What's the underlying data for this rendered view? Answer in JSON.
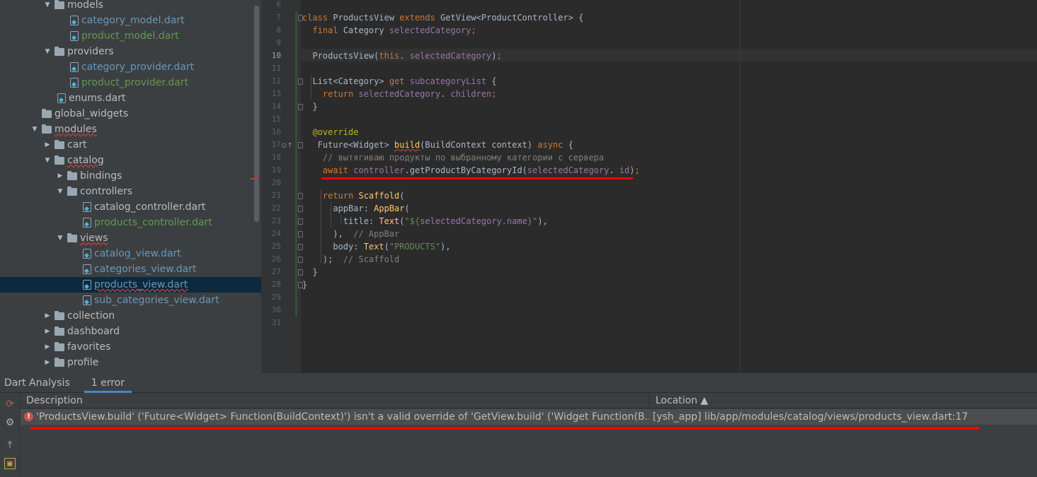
{
  "project_tree": {
    "items": [
      {
        "label": "models",
        "type": "folder",
        "expanded": true,
        "indent": 4,
        "color": "plain"
      },
      {
        "label": "category_model.dart",
        "type": "file",
        "indent": 6,
        "color": "blue"
      },
      {
        "label": "product_model.dart",
        "type": "file",
        "indent": 6,
        "color": "green"
      },
      {
        "label": "providers",
        "type": "folder",
        "expanded": true,
        "indent": 4,
        "color": "plain"
      },
      {
        "label": "category_provider.dart",
        "type": "file",
        "indent": 6,
        "color": "blue"
      },
      {
        "label": "product_provider.dart",
        "type": "file",
        "indent": 6,
        "color": "green"
      },
      {
        "label": "enums.dart",
        "type": "file",
        "indent": 5,
        "color": "plain"
      },
      {
        "label": "global_widgets",
        "type": "folder",
        "leaf": true,
        "indent": 3,
        "color": "plain"
      },
      {
        "label": "modules",
        "type": "folder",
        "expanded": true,
        "indent": 3,
        "color": "plain",
        "underlined": true
      },
      {
        "label": "cart",
        "type": "folder",
        "expanded": false,
        "indent": 4,
        "color": "plain"
      },
      {
        "label": "catalog",
        "type": "folder",
        "expanded": true,
        "indent": 4,
        "color": "plain",
        "underlined": true
      },
      {
        "label": "bindings",
        "type": "folder",
        "expanded": false,
        "indent": 5,
        "color": "plain"
      },
      {
        "label": "controllers",
        "type": "folder",
        "expanded": true,
        "indent": 5,
        "color": "plain"
      },
      {
        "label": "catalog_controller.dart",
        "type": "file",
        "indent": 7,
        "color": "plain"
      },
      {
        "label": "products_controller.dart",
        "type": "file",
        "indent": 7,
        "color": "green"
      },
      {
        "label": "views",
        "type": "folder",
        "expanded": true,
        "indent": 5,
        "color": "plain",
        "underlined": true
      },
      {
        "label": "catalog_view.dart",
        "type": "file",
        "indent": 7,
        "color": "blue"
      },
      {
        "label": "categories_view.dart",
        "type": "file",
        "indent": 7,
        "color": "blue"
      },
      {
        "label": "products_view.dart",
        "type": "file",
        "indent": 7,
        "color": "blue",
        "underlined": true,
        "selected": true
      },
      {
        "label": "sub_categories_view.dart",
        "type": "file",
        "indent": 7,
        "color": "blue"
      },
      {
        "label": "collection",
        "type": "folder",
        "expanded": false,
        "indent": 4,
        "color": "plain"
      },
      {
        "label": "dashboard",
        "type": "folder",
        "expanded": false,
        "indent": 4,
        "color": "plain"
      },
      {
        "label": "favorites",
        "type": "folder",
        "expanded": false,
        "indent": 4,
        "color": "plain"
      },
      {
        "label": "profile",
        "type": "folder",
        "expanded": false,
        "indent": 4,
        "color": "plain"
      }
    ]
  },
  "editor": {
    "current_line": "10",
    "lines": [
      {
        "n": "6",
        "tokens": []
      },
      {
        "n": "7",
        "tokens": [
          [
            "kw",
            "class "
          ],
          [
            "",
            "ProductsView "
          ],
          [
            "kw",
            "extends "
          ],
          [
            "",
            "GetView<ProductController> {"
          ]
        ]
      },
      {
        "n": "8",
        "tokens": [
          [
            "",
            "  "
          ],
          [
            "kw",
            "final "
          ],
          [
            "",
            "Category "
          ],
          [
            "fld",
            "selectedCategory"
          ],
          [
            "kw",
            ";"
          ]
        ]
      },
      {
        "n": "9",
        "tokens": []
      },
      {
        "n": "10",
        "tokens": [
          [
            "",
            "  ProductsView("
          ],
          [
            "kw",
            "this"
          ],
          [
            "",
            ". "
          ],
          [
            "fld",
            "selectedCategory"
          ],
          [
            "",
            ")"
          ],
          [
            "kw",
            ";"
          ]
        ]
      },
      {
        "n": "11",
        "tokens": []
      },
      {
        "n": "12",
        "tokens": [
          [
            "",
            "  List<Category> "
          ],
          [
            "kw",
            "get "
          ],
          [
            "fld",
            "subcategoryList "
          ],
          [
            "",
            "{"
          ]
        ]
      },
      {
        "n": "13",
        "tokens": [
          [
            "",
            "    "
          ],
          [
            "kw",
            "return "
          ],
          [
            "fld",
            "selectedCategory"
          ],
          [
            "",
            ". "
          ],
          [
            "fld",
            "children"
          ],
          [
            "kw",
            ";"
          ]
        ]
      },
      {
        "n": "14",
        "tokens": [
          [
            "",
            "  }"
          ]
        ]
      },
      {
        "n": "15",
        "tokens": []
      },
      {
        "n": "16",
        "tokens": [
          [
            "",
            "  "
          ],
          [
            "ann",
            "@override"
          ]
        ]
      },
      {
        "n": "17",
        "tokens": [
          [
            "",
            "   Future<Widget> "
          ],
          [
            "fn err-under",
            "build"
          ],
          [
            "",
            "(BuildContext context) "
          ],
          [
            "kw",
            "async "
          ],
          [
            "",
            "{"
          ]
        ]
      },
      {
        "n": "18",
        "tokens": [
          [
            "cmt",
            "    // вытягиваю продукты по выбранному категории с сервера"
          ]
        ]
      },
      {
        "n": "19",
        "tokens": [
          [
            "",
            "    "
          ],
          [
            "kw",
            "await "
          ],
          [
            "fld",
            "controller"
          ],
          [
            "",
            ".getProductByCategoryId("
          ],
          [
            "fld",
            "selectedCategory"
          ],
          [
            "",
            ". "
          ],
          [
            "fld",
            "id"
          ],
          [
            "",
            ")"
          ],
          [
            "kw",
            ";"
          ]
        ]
      },
      {
        "n": "20",
        "tokens": []
      },
      {
        "n": "21",
        "tokens": [
          [
            "",
            "    "
          ],
          [
            "kw",
            "return "
          ],
          [
            "fn",
            "Scaffold"
          ],
          [
            "",
            "("
          ]
        ]
      },
      {
        "n": "22",
        "tokens": [
          [
            "",
            "      appBar: "
          ],
          [
            "fn",
            "AppBar"
          ],
          [
            "",
            "("
          ]
        ]
      },
      {
        "n": "23",
        "tokens": [
          [
            "",
            "        title: "
          ],
          [
            "fn",
            "Text"
          ],
          [
            "",
            "("
          ],
          [
            "str",
            "\"${"
          ],
          [
            "fld",
            "selectedCategory"
          ],
          [
            "str",
            "."
          ],
          [
            "fld",
            "name"
          ],
          [
            "str",
            "}\""
          ],
          [
            "",
            "),"
          ]
        ]
      },
      {
        "n": "24",
        "tokens": [
          [
            "",
            "      ),  "
          ],
          [
            "cmt",
            "// AppBar"
          ]
        ]
      },
      {
        "n": "25",
        "tokens": [
          [
            "",
            "      body: "
          ],
          [
            "fn",
            "Text"
          ],
          [
            "",
            "("
          ],
          [
            "str",
            "\"PRODUCTS\""
          ],
          [
            "",
            "),"
          ]
        ]
      },
      {
        "n": "26",
        "tokens": [
          [
            "",
            "    );  "
          ],
          [
            "cmt",
            "// Scaffold"
          ]
        ]
      },
      {
        "n": "27",
        "tokens": [
          [
            "",
            "  }"
          ]
        ]
      },
      {
        "n": "28",
        "tokens": [
          [
            "",
            "}"
          ]
        ]
      },
      {
        "n": "29",
        "tokens": []
      },
      {
        "n": "30",
        "tokens": []
      },
      {
        "n": "31",
        "tokens": []
      }
    ]
  },
  "bottom_panel": {
    "title": "Dart Analysis",
    "tab_label": "1 error",
    "columns": {
      "description": "Description",
      "location": "Location ▲"
    },
    "issues": [
      {
        "severity": "error",
        "description": "'ProductsView.build' ('Future<Widget> Function(BuildContext)') isn't a valid override of 'GetView.build' ('Widget Function(B...",
        "location": "[ysh_app] lib/app/modules/catalog/views/products_view.dart:17"
      }
    ],
    "tool_icons": [
      "refresh-icon",
      "settings-icon",
      "pin-icon",
      "layout-icon"
    ]
  },
  "colors": {
    "tree_bg": "#3c3f41",
    "editor_bg": "#2b2b2b",
    "selection": "#0d293e",
    "error_red": "#ff0000"
  }
}
